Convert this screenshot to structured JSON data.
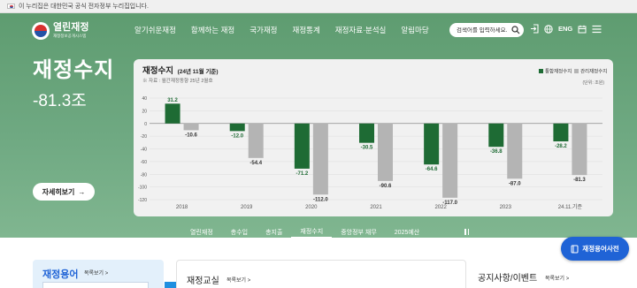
{
  "topbar": {
    "notice": "이 누리집은 대한민국 공식 전자정부 누리집입니다."
  },
  "logo": {
    "title": "열린재정",
    "subtitle": "재정정보공개시스템"
  },
  "nav": {
    "items": [
      "알기쉬운재정",
      "함께하는 재정",
      "국가재정",
      "재정통계",
      "재정자료·분석실",
      "알림마당"
    ]
  },
  "search": {
    "placeholder": "검색어를 입력하세요."
  },
  "util": {
    "lang": "ENG"
  },
  "hero": {
    "title": "재정수지",
    "value": "-81.3조",
    "more_label": "자세히보기",
    "more_arrow": "→"
  },
  "chart_data": {
    "type": "bar",
    "title": "재정수지",
    "title_note": "(24년 11월 기준)",
    "source": "※ 자료 : 월간재정동향 25년 2월호",
    "unit": "(단위: 조원)",
    "categories": [
      "2018",
      "2019",
      "2020",
      "2021",
      "2022",
      "2023",
      "24.11.기준"
    ],
    "series": [
      {
        "name": "통합재정수지",
        "color": "#1e6b34",
        "values": [
          31.2,
          -12.0,
          -71.2,
          -30.5,
          -64.6,
          -36.8,
          -28.2
        ]
      },
      {
        "name": "관리재정수지",
        "color": "#b4b4b4",
        "values": [
          -10.6,
          -54.4,
          -112.0,
          -90.6,
          -117.0,
          -87.0,
          -81.3
        ]
      }
    ],
    "value_labels": [
      [
        "31.2",
        "-12.0",
        "-71.2",
        "-30.5",
        "-64.6",
        "-36.8",
        "-28.2"
      ],
      [
        "-10.6",
        "-54.4",
        "-112.0",
        "-90.6",
        "-117.0",
        "-87.0",
        "-81.3"
      ]
    ],
    "yticks": [
      40,
      20,
      0,
      -20,
      -40,
      -60,
      -80,
      -100,
      -120
    ],
    "ylim": [
      -120,
      40
    ],
    "grid": true,
    "legend": "top-right"
  },
  "tabs": [
    "열린재정",
    "총수입",
    "총지출",
    "재정수지",
    "중앙정부 채무",
    "2025예산"
  ],
  "active_tab": "재정수지",
  "dictionary_button": "재정용어사전",
  "sections": {
    "term": {
      "title": "재정용어",
      "more": "목록보기 >"
    },
    "edu": {
      "title": "재정교실",
      "more": "목록보기 >"
    },
    "notice": {
      "title": "공지사항/이벤트",
      "more": "목록보기 >"
    }
  }
}
